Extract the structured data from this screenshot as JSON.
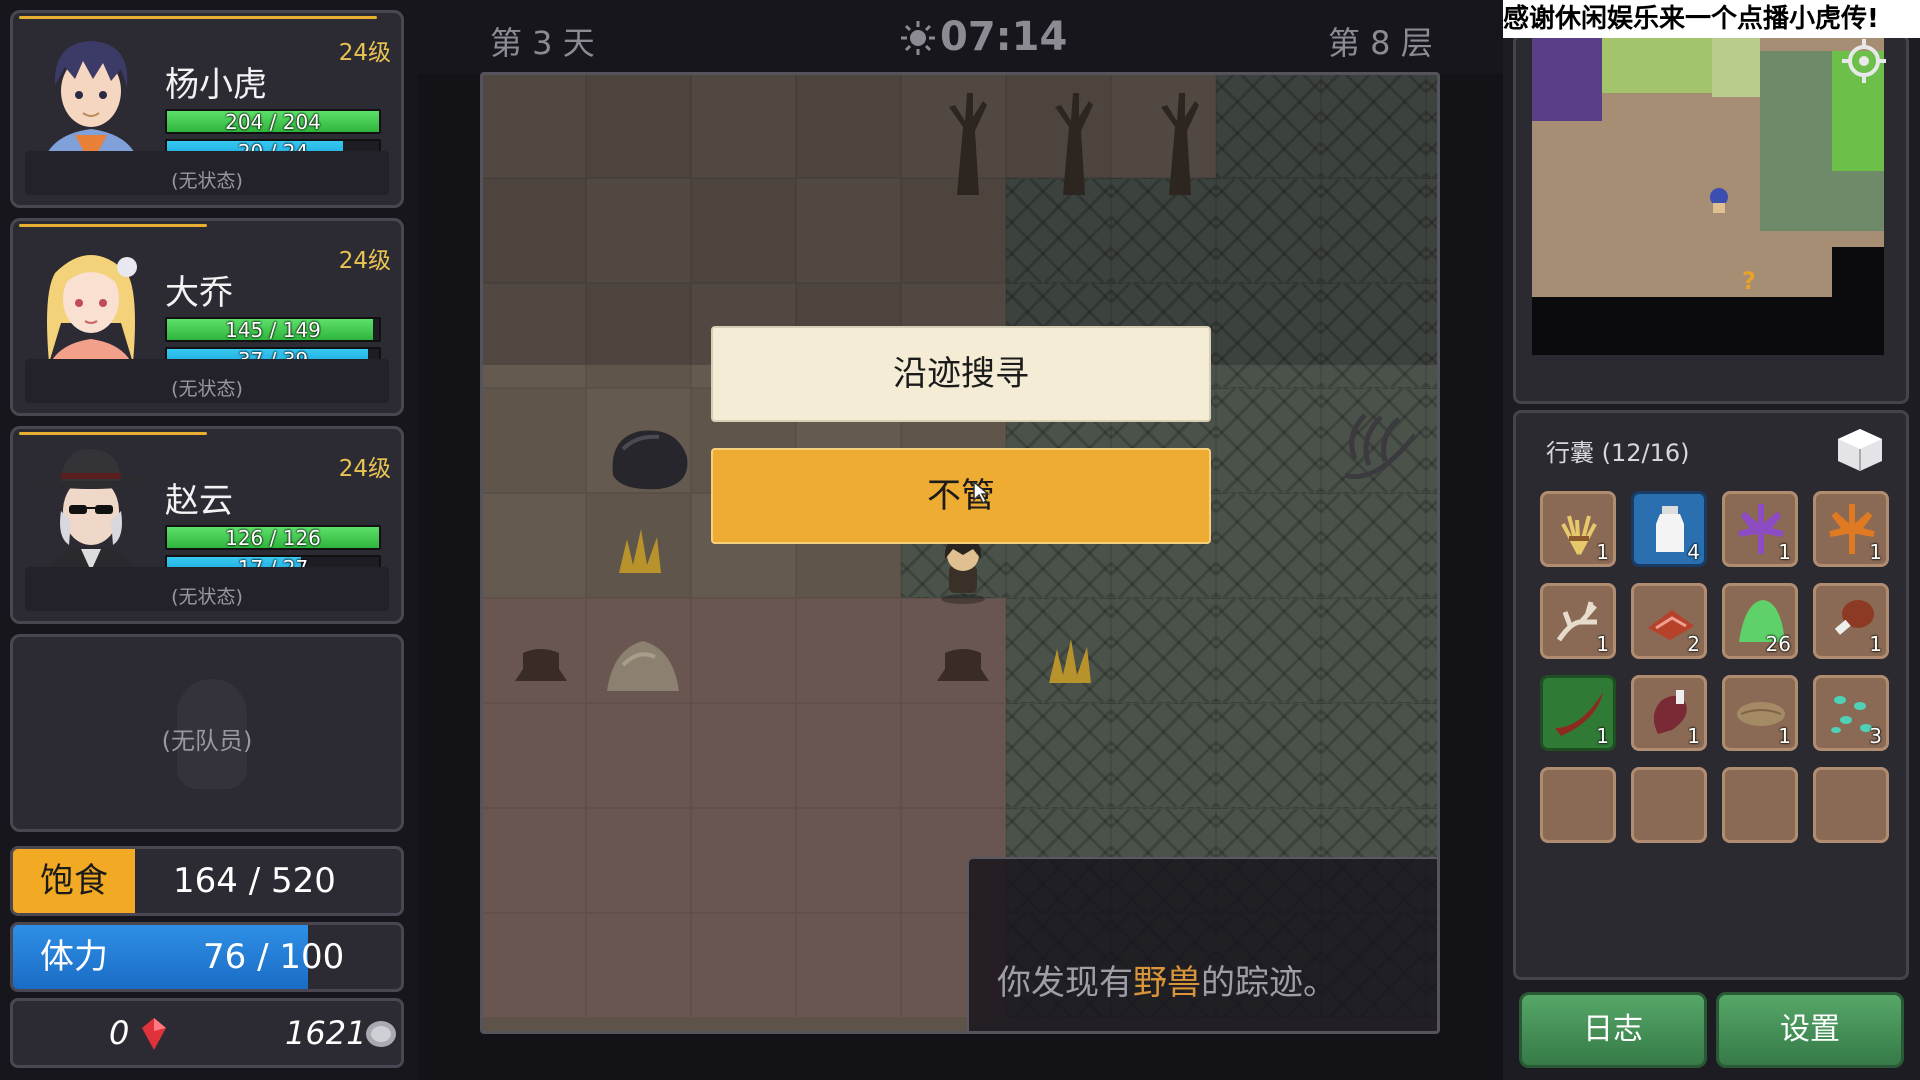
{
  "party": [
    {
      "name": "杨小虎",
      "level": "24级",
      "hp_text": "204 / 204",
      "hp_fraction": 1.0,
      "mp_text": "20 / 24",
      "mp_fraction": 0.83,
      "xp_fraction": 0.92,
      "status": "(无状态)"
    },
    {
      "name": "大乔",
      "level": "24级",
      "hp_text": "145 / 149",
      "hp_fraction": 0.97,
      "mp_text": "37 / 39",
      "mp_fraction": 0.95,
      "xp_fraction": 0.4,
      "status": "(无状态)"
    },
    {
      "name": "赵云",
      "level": "24级",
      "hp_text": "126 / 126",
      "hp_fraction": 1.0,
      "mp_text": "17 / 27",
      "mp_fraction": 0.63,
      "xp_fraction": 0.4,
      "status": "(无状态)"
    }
  ],
  "empty_member": "(无队员)",
  "food": {
    "label": "饱食",
    "value": "164  / 520"
  },
  "stamina": {
    "label": "体力",
    "value": "76  / 100",
    "fraction": 0.76
  },
  "money": {
    "gems": "0",
    "coins": "1621"
  },
  "topbar": {
    "day": "第 3 天",
    "time": "07:14",
    "floor": "第 8 层"
  },
  "event": {
    "choices": [
      "沿迹搜寻",
      "不管"
    ],
    "text_before": "你发现有",
    "text_highlight": "野兽",
    "text_after": "的踪迹。"
  },
  "banner": "感谢休闲娱乐来一个点播小虎传!",
  "bag": {
    "title": "行囊 (12/16)",
    "items": [
      {
        "icon": "wheat-bundle-icon",
        "qty": "1",
        "style": "normal"
      },
      {
        "icon": "milk-bottle-icon",
        "qty": "4",
        "style": "selected"
      },
      {
        "icon": "purple-leaf-icon",
        "qty": "1",
        "style": "normal"
      },
      {
        "icon": "maple-leaf-icon",
        "qty": "1",
        "style": "normal"
      },
      {
        "icon": "antler-icon",
        "qty": "1",
        "style": "normal"
      },
      {
        "icon": "raw-meat-slice-icon",
        "qty": "2",
        "style": "normal"
      },
      {
        "icon": "green-powder-icon",
        "qty": "26",
        "style": "normal"
      },
      {
        "icon": "drumstick-icon",
        "qty": "1",
        "style": "normal"
      },
      {
        "icon": "horn-icon",
        "qty": "1",
        "style": "green"
      },
      {
        "icon": "meat-leg-icon",
        "qty": "1",
        "style": "normal"
      },
      {
        "icon": "fish-fillet-icon",
        "qty": "1",
        "style": "normal"
      },
      {
        "icon": "teal-seeds-icon",
        "qty": "3",
        "style": "normal"
      },
      {
        "icon": "",
        "qty": "",
        "style": "empty"
      },
      {
        "icon": "",
        "qty": "",
        "style": "empty"
      },
      {
        "icon": "",
        "qty": "",
        "style": "empty"
      },
      {
        "icon": "",
        "qty": "",
        "style": "empty"
      }
    ]
  },
  "buttons": {
    "log": "日志",
    "settings": "设置"
  }
}
